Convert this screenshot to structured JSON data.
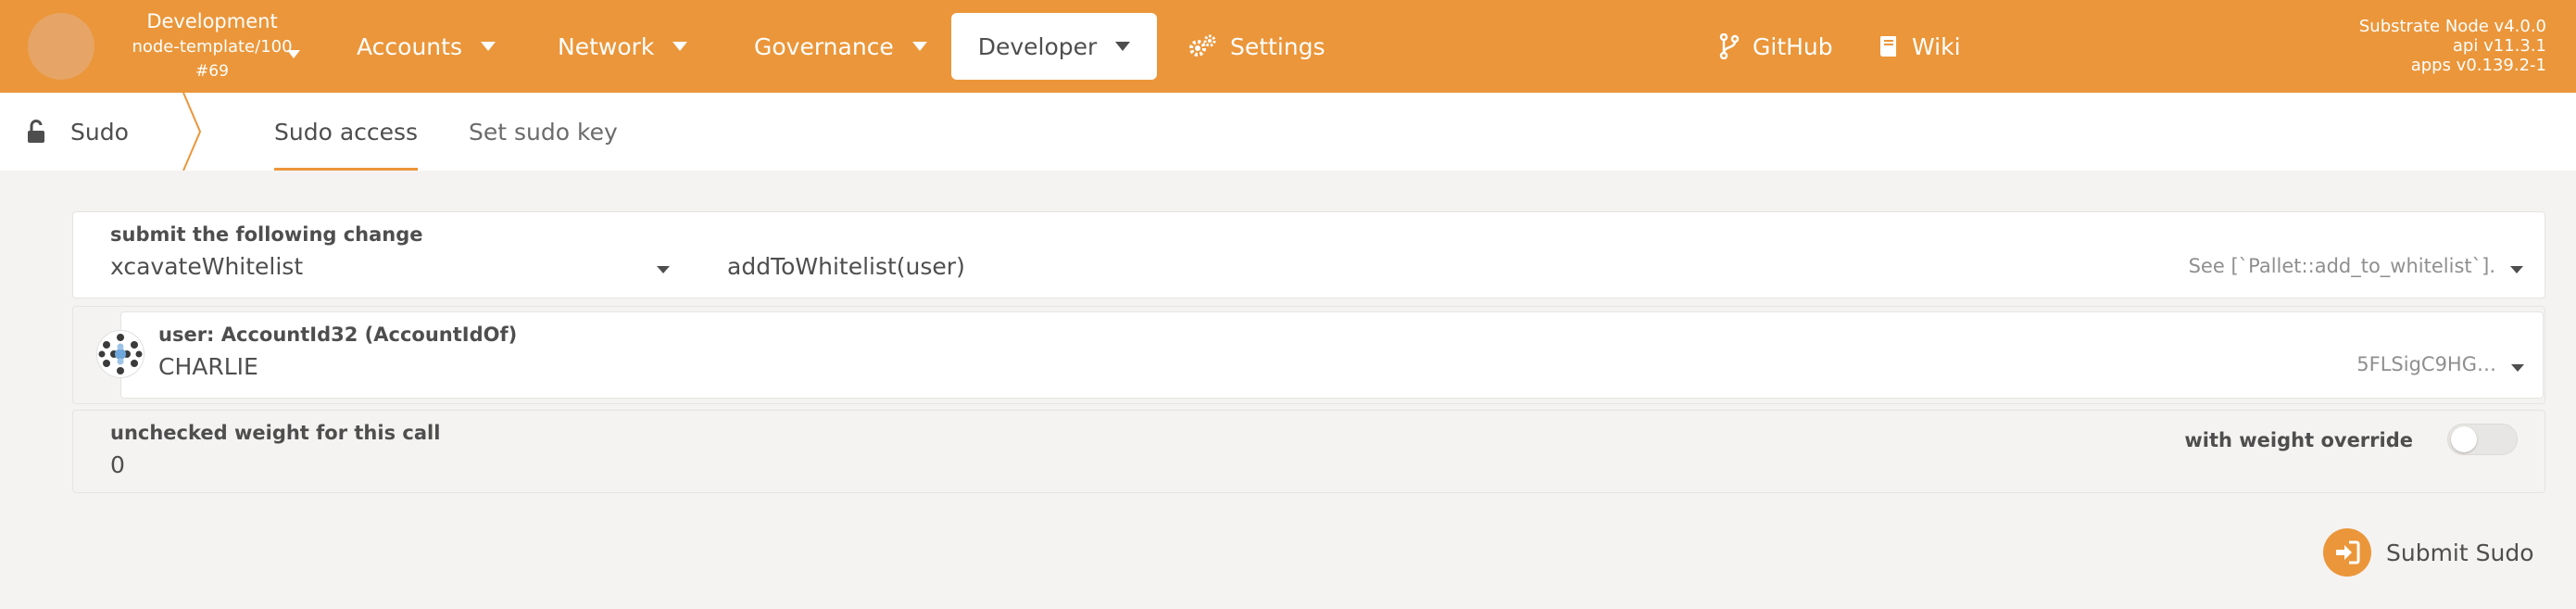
{
  "header": {
    "chain": {
      "name": "Development",
      "runtime": "node-template/100",
      "block": "#69"
    },
    "nav": [
      {
        "label": "Accounts"
      },
      {
        "label": "Network"
      },
      {
        "label": "Governance"
      },
      {
        "label": "Developer"
      },
      {
        "label": "Settings",
        "icon": "gears-icon"
      }
    ],
    "links": [
      {
        "label": "GitHub",
        "icon": "git-branch-icon"
      },
      {
        "label": "Wiki",
        "icon": "book-icon"
      }
    ],
    "versions": {
      "node": "Substrate Node v4.0.0",
      "api": "api v11.3.1",
      "apps": "apps v0.139.2-1"
    }
  },
  "subnav": {
    "section": "Sudo",
    "section_icon": "unlock-icon",
    "tabs": [
      {
        "label": "Sudo access",
        "active": true
      },
      {
        "label": "Set sudo key",
        "active": false
      }
    ]
  },
  "form": {
    "change": {
      "label": "submit the following change",
      "pallet": "xcavateWhitelist",
      "method": "addToWhitelist(user)",
      "doc": "See [`Pallet::add_to_whitelist`]."
    },
    "user": {
      "label": "user: AccountId32 (AccountIdOf)",
      "value": "CHARLIE",
      "address": "5FLSigC9HG…"
    },
    "weight": {
      "label": "unchecked weight for this call",
      "value": "0",
      "override_label": "with weight override",
      "override_enabled": false
    },
    "submit_label": "Submit Sudo"
  },
  "colors": {
    "accent": "#eb963a",
    "background": "#f4f3f1",
    "text": "#4e4e4e"
  }
}
